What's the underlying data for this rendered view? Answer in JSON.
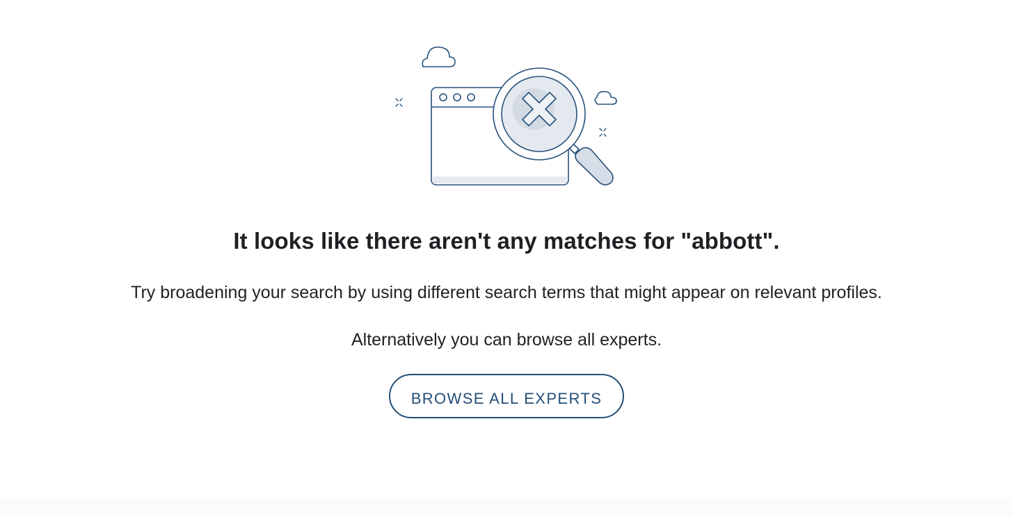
{
  "empty_state": {
    "illustration": {
      "icon": "no-results-magnifier-icon",
      "colors": {
        "stroke": "#27507a",
        "fill": "#dfe4ec",
        "shade": "#c7d0dc"
      }
    },
    "heading": "It looks like there aren't any matches for \"abbott\".",
    "suggestion": "Try broadening your search by using different search terms that might appear on relevant profiles.",
    "alternative": "Alternatively you can browse all experts.",
    "button": {
      "label": "BROWSE ALL EXPERTS",
      "color": "#244e78"
    }
  }
}
